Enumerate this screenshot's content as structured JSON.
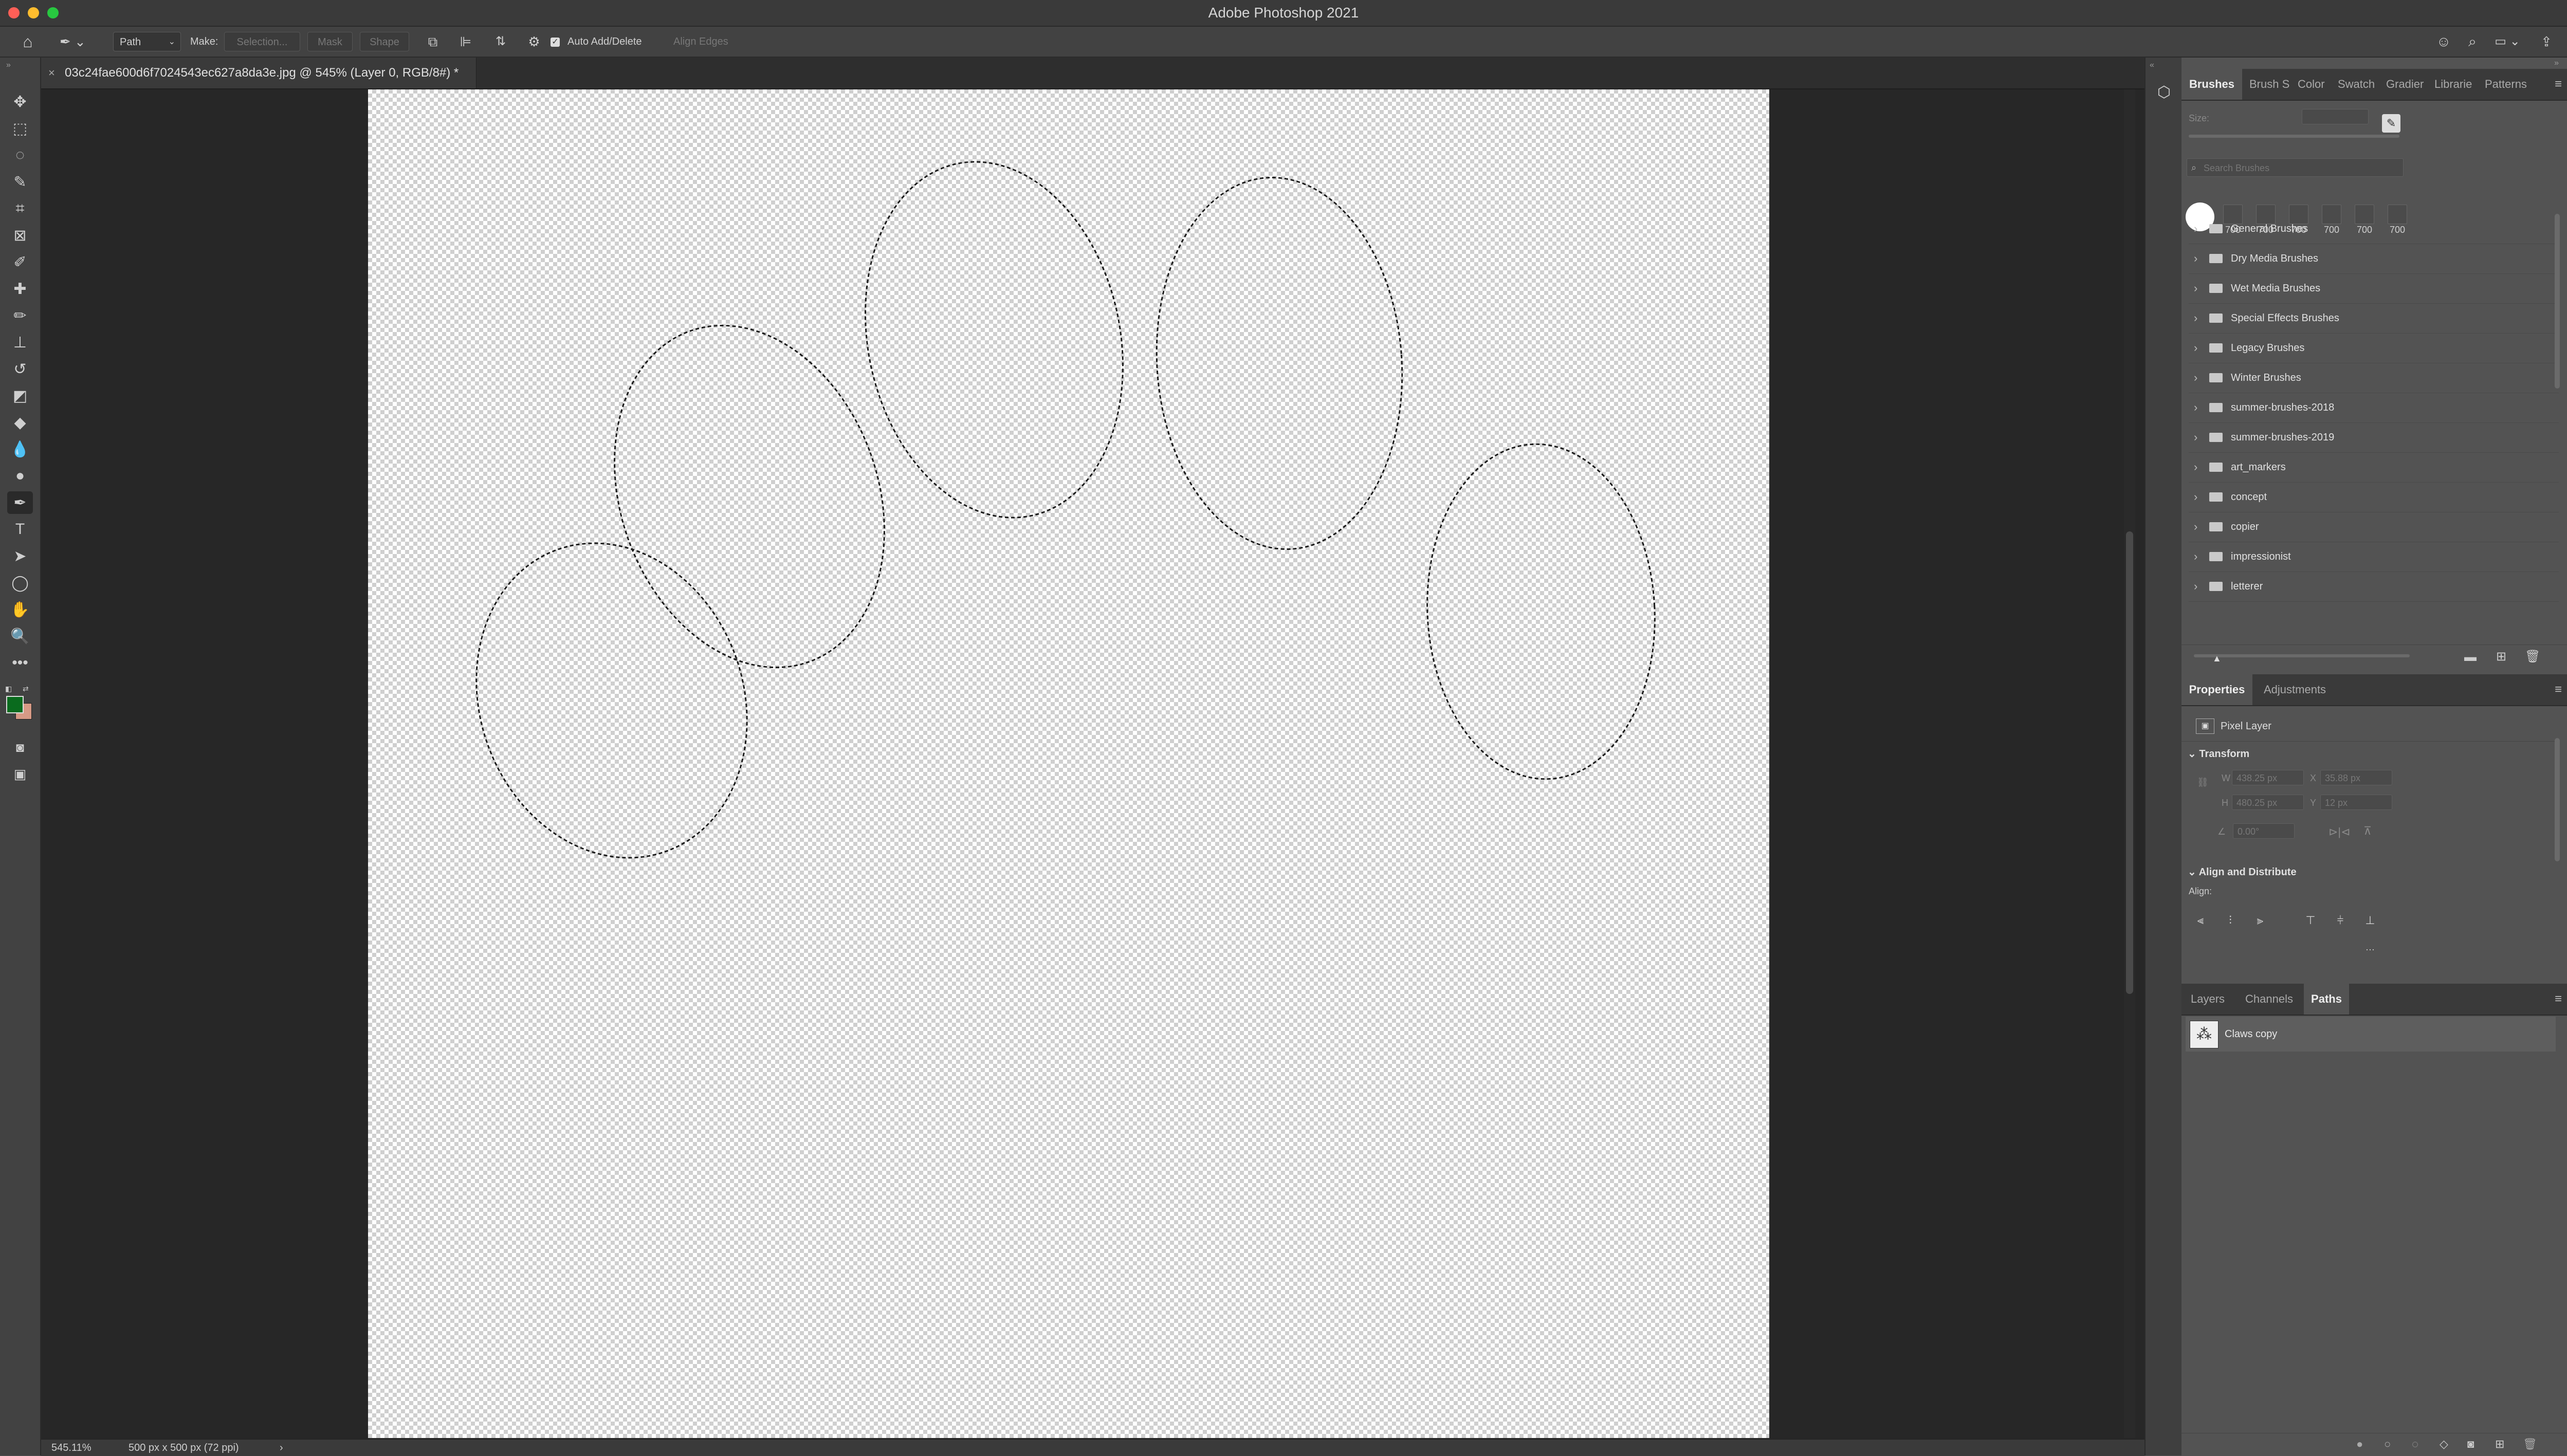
{
  "window": {
    "title": "Adobe Photoshop 2021"
  },
  "options_bar": {
    "mode": "Path",
    "make_label": "Make:",
    "selection_button": "Selection...",
    "mask_button": "Mask",
    "shape_button": "Shape",
    "auto_add_delete": "Auto Add/Delete",
    "align_edges": "Align Edges"
  },
  "document": {
    "tab_title": "03c24fae600d6f7024543ec627a8da3e.jpg @ 545% (Layer 0, RGB/8#) *",
    "zoom": "545.11%",
    "doc_info": "500 px x 500 px (72 ppi)"
  },
  "tools": [
    "move-icon",
    "marquee-icon",
    "lasso-icon",
    "quick-select-icon",
    "crop-icon",
    "frame-icon",
    "eyedropper-icon",
    "healing-icon",
    "brush-icon",
    "stamp-icon",
    "history-brush-icon",
    "eraser-icon",
    "paint-bucket-icon",
    "blur-icon",
    "dodge-icon",
    "pen-icon",
    "type-icon",
    "path-select-icon",
    "ellipse-icon",
    "hand-icon",
    "zoom-icon",
    "more-icon"
  ],
  "colors": {
    "foreground": "#0a6b1e",
    "background": "#d79a86",
    "accent": "#2d8ceb"
  },
  "brushes_panel": {
    "tabs": [
      "Brushes",
      "Brush S",
      "Color",
      "Swatch",
      "Gradier",
      "Librarie",
      "Patterns"
    ],
    "size_label": "Size:",
    "search_placeholder": "Search Brushes",
    "recent_sizes": [
      "700",
      "700",
      "700",
      "700",
      "700",
      "700"
    ],
    "folders": [
      "General Brushes",
      "Dry Media Brushes",
      "Wet Media Brushes",
      "Special Effects Brushes",
      "Legacy Brushes",
      "Winter Brushes",
      "summer-brushes-2018",
      "summer-brushes-2019",
      "art_markers",
      "concept",
      "copier",
      "impressionist",
      "letterer"
    ]
  },
  "properties_panel": {
    "tabs": [
      "Properties",
      "Adjustments"
    ],
    "layer_type": "Pixel Layer",
    "transform_heading": "Transform",
    "w_label": "W",
    "w_value": "438.25 px",
    "x_label": "X",
    "x_value": "35.88 px",
    "h_label": "H",
    "h_value": "480.25 px",
    "y_label": "Y",
    "y_value": "12 px",
    "angle_value": "0.00°",
    "align_heading": "Align and Distribute",
    "align_label": "Align:"
  },
  "layers_panel": {
    "tabs": [
      "Layers",
      "Channels",
      "Paths"
    ],
    "paths": [
      {
        "name": "Claws copy"
      }
    ]
  }
}
